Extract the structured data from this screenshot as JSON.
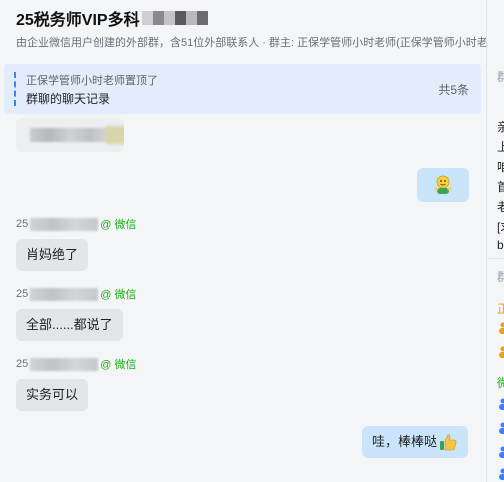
{
  "header": {
    "title": "25税务师VIP多科",
    "subtitle": "由企业微信用户创建的外部群，含51位外部联系人 · 群主: 正保学管师小时老师(正保学管师小时老师)"
  },
  "pinned": {
    "label": "正保学管师小时老师置顶了",
    "content": "群聊的聊天记录",
    "count": "共5条"
  },
  "messages": [
    {
      "sender_prefix": "25",
      "source": "@ 微信",
      "text": "肖妈绝了"
    },
    {
      "sender_prefix": "25",
      "source": "@ 微信",
      "text": "全部......都说了"
    },
    {
      "sender_prefix": "25",
      "source": "@ 微信",
      "text": "实务可以"
    }
  ],
  "self_messages": {
    "last": "哇，棒棒哒"
  },
  "right_panel": {
    "section1_title": "群",
    "lines": [
      "亲",
      "上",
      "咱",
      "首",
      "老",
      "[求",
      "b"
    ],
    "section2_title": "群",
    "member_initial_1": "正",
    "member_initial_2": "微"
  },
  "icons": {
    "emoji_sticker": "smiley-hug-icon",
    "thumbs_up": "thumbs-up-icon",
    "person": "person-icon"
  },
  "colors": {
    "accent": "#3b82f6",
    "wechat_green": "#1aad19",
    "pinned_bg": "#e3ecfb",
    "self_bubble": "#c9e4fb",
    "other_bubble": "#e3e5e9"
  }
}
